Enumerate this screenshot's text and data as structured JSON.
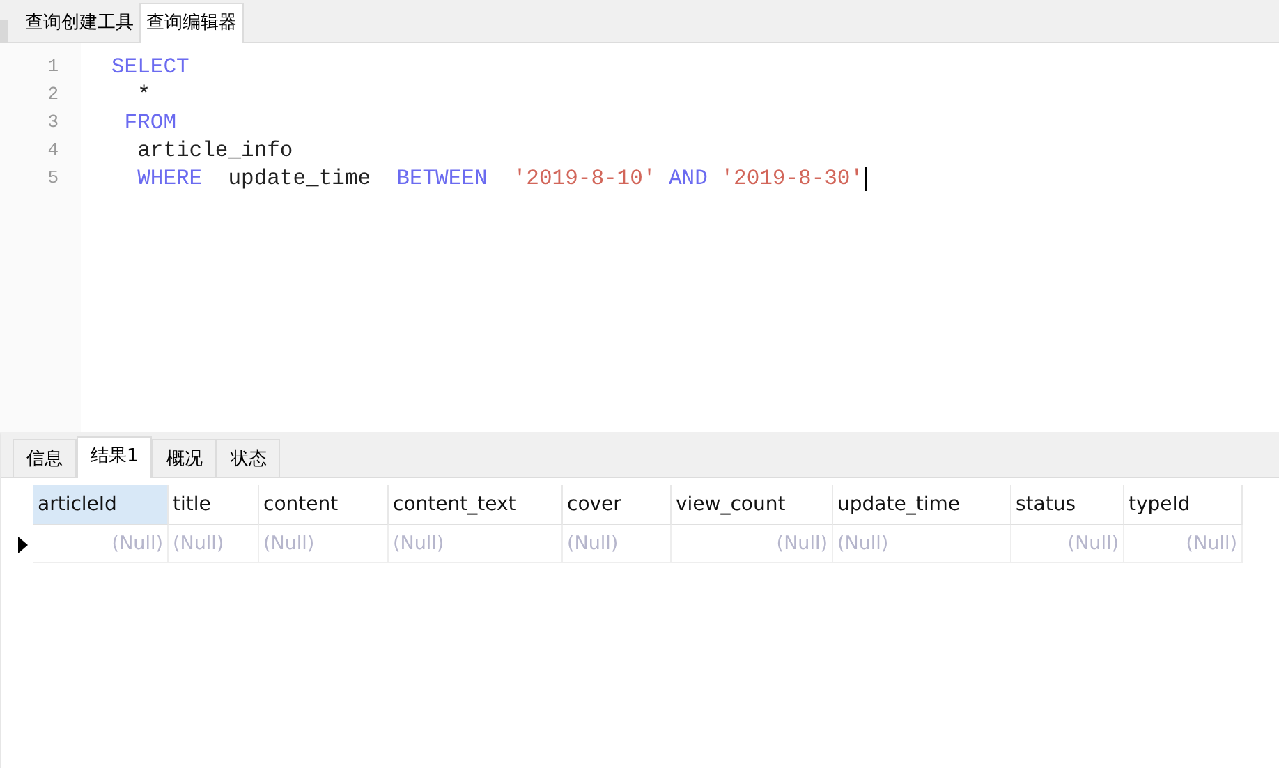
{
  "editor_tabs": [
    {
      "label": "查询创建工具",
      "selected": false
    },
    {
      "label": "查询编辑器",
      "selected": true
    }
  ],
  "editor": {
    "lines": [
      {
        "number": "1",
        "tokens": [
          {
            "kind": "keyword",
            "text": "SELECT"
          }
        ]
      },
      {
        "number": "2",
        "tokens": [
          {
            "kind": "plain",
            "text": "  *"
          }
        ]
      },
      {
        "number": "3",
        "tokens": [
          {
            "kind": "keyword",
            "text": " FROM"
          }
        ]
      },
      {
        "number": "4",
        "tokens": [
          {
            "kind": "plain",
            "text": "  article_info"
          }
        ]
      },
      {
        "number": "5",
        "tokens": [
          {
            "kind": "keyword",
            "text": "  WHERE"
          },
          {
            "kind": "plain",
            "text": "  update_time  "
          },
          {
            "kind": "keyword",
            "text": "BETWEEN"
          },
          {
            "kind": "string",
            "text": "  '2019-8-10'"
          },
          {
            "kind": "keyword",
            "text": " AND"
          },
          {
            "kind": "string",
            "text": " '2019-8-30'"
          }
        ],
        "cursor": true
      }
    ]
  },
  "result_tabs": [
    {
      "label": "信息",
      "selected": false
    },
    {
      "label": "结果1",
      "selected": true
    },
    {
      "label": "概况",
      "selected": false
    },
    {
      "label": "状态",
      "selected": false
    }
  ],
  "table": {
    "columns": [
      {
        "label": "articleId",
        "kind": "number",
        "selected": true
      },
      {
        "label": "title",
        "kind": "text",
        "selected": false
      },
      {
        "label": "content",
        "kind": "text",
        "selected": false
      },
      {
        "label": "content_text",
        "kind": "text",
        "selected": false
      },
      {
        "label": "cover",
        "kind": "text",
        "selected": false
      },
      {
        "label": "view_count",
        "kind": "number",
        "selected": false
      },
      {
        "label": "update_time",
        "kind": "text",
        "selected": false
      },
      {
        "label": "status",
        "kind": "number",
        "selected": false
      },
      {
        "label": "typeId",
        "kind": "number",
        "selected": false
      }
    ],
    "rows": [
      {
        "current": true,
        "cells": [
          "(Null)",
          "(Null)",
          "(Null)",
          "(Null)",
          "(Null)",
          "(Null)",
          "(Null)",
          "(Null)",
          "(Null)"
        ]
      }
    ]
  }
}
